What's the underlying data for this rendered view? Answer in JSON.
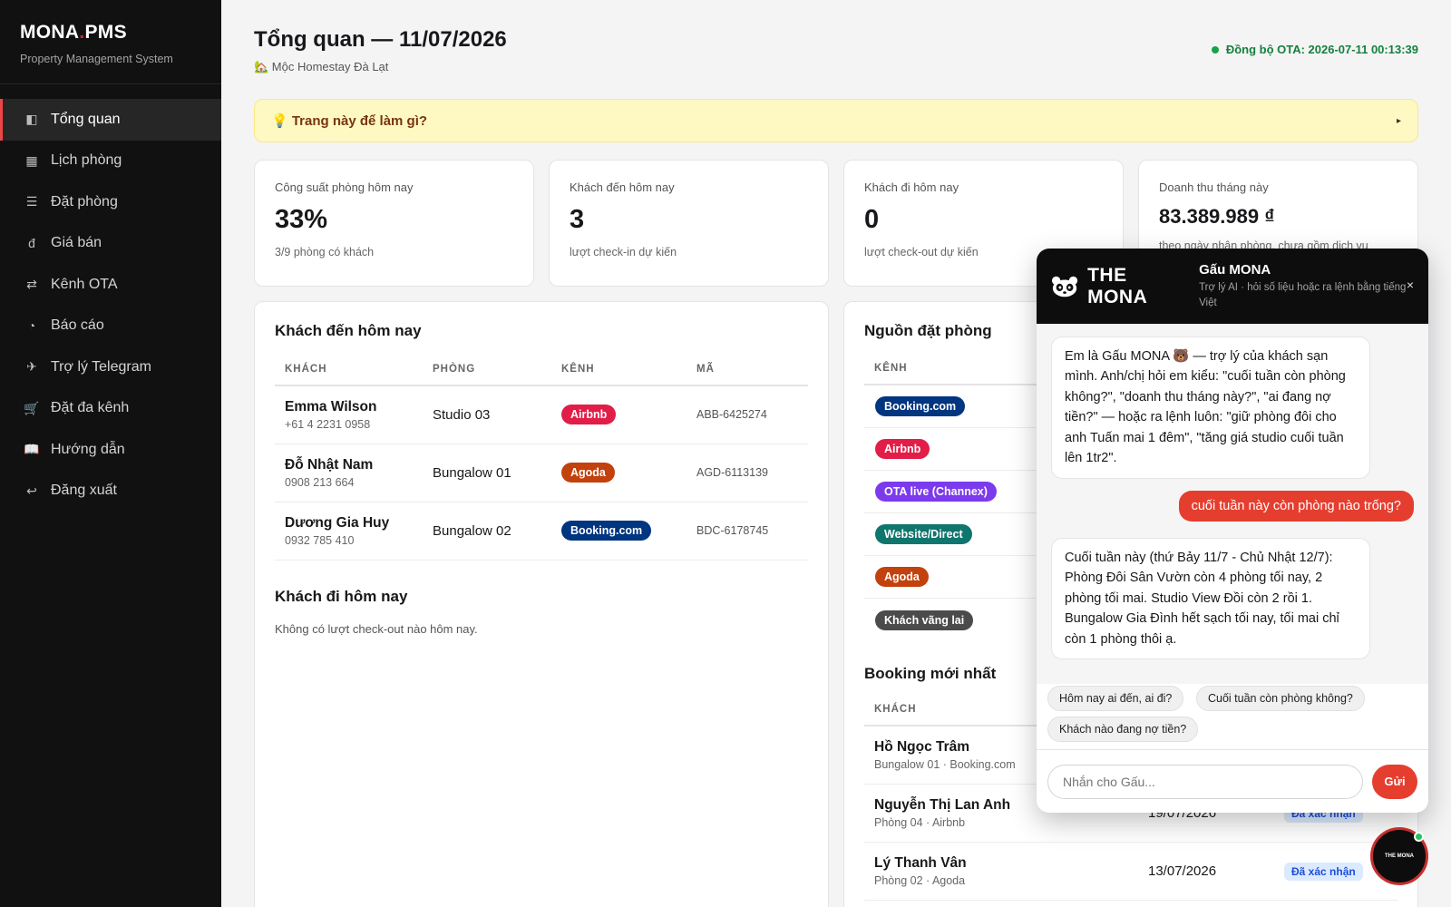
{
  "brand": {
    "name_a": "MONA",
    "name_dot": ".",
    "name_b": "PMS",
    "subtitle": "Property Management System"
  },
  "nav": [
    {
      "icon": "◧",
      "label": "Tổng quan",
      "active": true
    },
    {
      "icon": "▦",
      "label": "Lịch phòng"
    },
    {
      "icon": "☰",
      "label": "Đặt phòng"
    },
    {
      "icon": "đ",
      "label": "Giá bán"
    },
    {
      "icon": "⇄",
      "label": "Kênh OTA"
    },
    {
      "icon": "◔",
      "label": "Báo cáo"
    },
    {
      "icon": "✈",
      "label": "Trợ lý Telegram"
    },
    {
      "icon": "🛒",
      "label": "Đặt đa kênh"
    },
    {
      "icon": "📖",
      "label": "Hướng dẫn"
    },
    {
      "icon": "↩",
      "label": "Đăng xuất"
    }
  ],
  "header": {
    "title": "Tổng quan — 11/07/2026",
    "property": "🏡 Mộc Homestay Đà Lạt",
    "sync": "Đồng bộ OTA: 2026-07-11 00:13:39"
  },
  "help": {
    "label": "💡 Trang này để làm gì?",
    "arrow": "▸"
  },
  "stats": [
    {
      "label": "Công suất phòng hôm nay",
      "value": "33%",
      "note": "3/9 phòng có khách"
    },
    {
      "label": "Khách đến hôm nay",
      "value": "3",
      "note": "lượt check-in dự kiến"
    },
    {
      "label": "Khách đi hôm nay",
      "value": "0",
      "note": "lượt check-out dự kiến"
    },
    {
      "label": "Doanh thu tháng này",
      "value": "83.389.989 ₫",
      "note": "theo ngày nhận phòng, chưa gồm dịch vụ"
    }
  ],
  "arrivals": {
    "title": "Khách đến hôm nay",
    "columns": [
      "KHÁCH",
      "PHÒNG",
      "KÊNH",
      "MÃ"
    ],
    "rows": [
      {
        "name": "Emma Wilson",
        "phone": "+61 4 2231 0958",
        "room": "Studio 03",
        "channel": "Airbnb",
        "color": "#e11d48",
        "code": "ABB-6425274"
      },
      {
        "name": "Đỗ Nhật Nam",
        "phone": "0908 213 664",
        "room": "Bungalow 01",
        "channel": "Agoda",
        "color": "#c2410c",
        "code": "AGD-6113139"
      },
      {
        "name": "Dương Gia Huy",
        "phone": "0932 785 410",
        "room": "Bungalow 02",
        "channel": "Booking.com",
        "color": "#003580",
        "code": "BDC-6178745"
      }
    ]
  },
  "departures": {
    "title": "Khách đi hôm nay",
    "empty": "Không có lượt check-out nào hôm nay."
  },
  "sources": {
    "title": "Nguồn đặt phòng",
    "column": "KÊNH",
    "items": [
      {
        "label": "Booking.com",
        "color": "#003580"
      },
      {
        "label": "Airbnb",
        "color": "#e11d48"
      },
      {
        "label": "OTA live (Channex)",
        "color": "#7c3aed"
      },
      {
        "label": "Website/Direct",
        "color": "#0f766e"
      },
      {
        "label": "Agoda",
        "color": "#c2410c"
      },
      {
        "label": "Khách vãng lai",
        "color": "#4b4b4b"
      }
    ]
  },
  "latest": {
    "title": "Booking mới nhất",
    "column": "KHÁCH",
    "rows": [
      {
        "name": "Hồ Ngọc Trâm",
        "detail": "Bungalow 01 · Booking.com",
        "date": "",
        "status": ""
      },
      {
        "name": "Nguyễn Thị Lan Anh",
        "detail": "Phòng 04 · Airbnb",
        "date": "19/07/2026",
        "status": "Đã xác nhận"
      },
      {
        "name": "Lý Thanh Vân",
        "detail": "Phòng 02 · Agoda",
        "date": "13/07/2026",
        "status": "Đã xác nhận"
      }
    ]
  },
  "chat": {
    "logo": "THE MONA",
    "title": "Gấu MONA",
    "subtitle": "Trợ lý AI · hỏi số liệu hoặc ra lệnh bằng tiếng Việt",
    "close": "×",
    "bot_msg_1": "Em là Gấu MONA 🐻 — trợ lý của khách sạn mình. Anh/chị hỏi em kiểu: \"cuối tuần còn phòng không?\", \"doanh thu tháng này?\", \"ai đang nợ tiền?\" — hoặc ra lệnh luôn: \"giữ phòng đôi cho anh Tuấn mai 1 đêm\", \"tăng giá studio cuối tuần lên 1tr2\".",
    "user_msg": "cuối tuần này còn phòng nào trống?",
    "bot_msg_2": "Cuối tuần này (thứ Bảy 11/7 - Chủ Nhật 12/7): Phòng Đôi Sân Vườn còn 4 phòng tối nay, 2 phòng tối mai. Studio View Đồi còn 2 rồi 1. Bungalow Gia Đình hết sạch tối nay, tối mai chỉ còn 1 phòng thôi ạ.",
    "suggestions": [
      "Hôm nay ai đến, ai đi?",
      "Cuối tuần còn phòng không?",
      "Khách nào đang nợ tiền?"
    ],
    "input_placeholder": "Nhắn cho Gấu...",
    "send_label": "Gửi",
    "fab_label": "THE MONA"
  }
}
